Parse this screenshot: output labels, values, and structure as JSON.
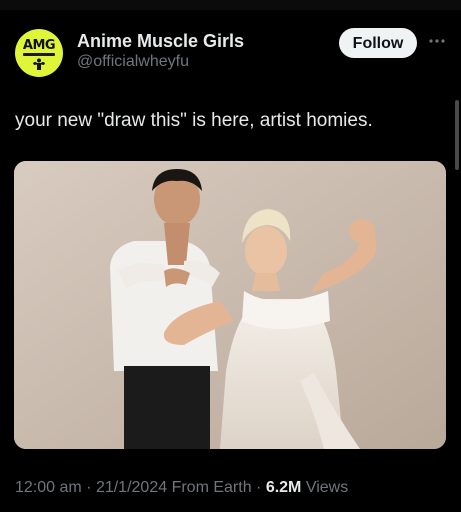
{
  "account": {
    "display_name": "Anime Muscle Girls",
    "handle": "@officialwheyfu",
    "avatar_label": "AMG",
    "avatar_color": "#dff53a"
  },
  "actions": {
    "follow_label": "Follow",
    "more_icon": "more-horizontal-icon"
  },
  "tweet": {
    "text": "your new \"draw this\" is here, artist homies.",
    "media_description_icon": "photo"
  },
  "meta": {
    "time": "12:00 am",
    "separator_1": " · ",
    "date": "21/1/2024",
    "source": " From Earth",
    "separator_2": " · ",
    "views_count": "6.2M",
    "views_label": " Views"
  },
  "colors": {
    "background": "#000000",
    "primary_text": "#e7e9ea",
    "secondary_text": "#71767b",
    "follow_button_bg": "#eff3f4"
  }
}
